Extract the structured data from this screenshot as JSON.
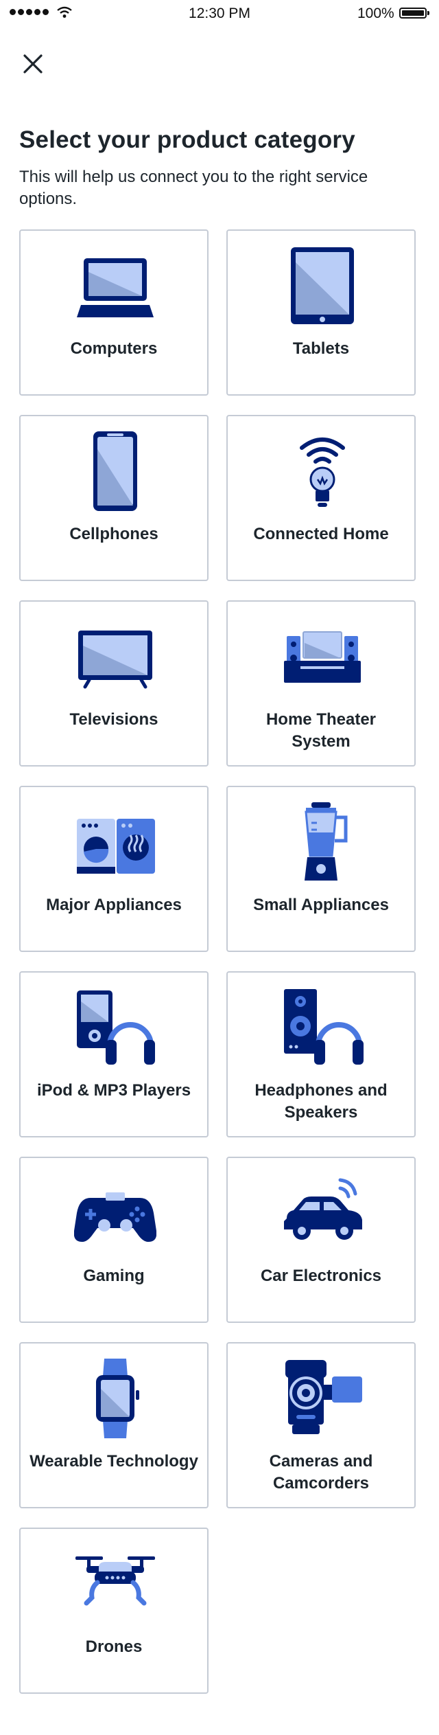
{
  "status_bar": {
    "time": "12:30 PM",
    "battery": "100%"
  },
  "header": {
    "title": "Select your product category",
    "subtitle": "This will help us connect you to the right service options."
  },
  "colors": {
    "navy": "#001e73",
    "blue": "#4a78e0",
    "light_blue": "#b9cdf7",
    "slate": "#8ea6d6",
    "border": "#c5cbd5"
  },
  "categories": [
    {
      "label": "Computers",
      "icon": "laptop-icon"
    },
    {
      "label": "Tablets",
      "icon": "tablet-icon"
    },
    {
      "label": "Cellphones",
      "icon": "cellphone-icon"
    },
    {
      "label": "Connected Home",
      "icon": "smart-bulb-icon"
    },
    {
      "label": "Televisions",
      "icon": "television-icon"
    },
    {
      "label": "Home Theater System",
      "icon": "home-theater-icon"
    },
    {
      "label": "Major Appliances",
      "icon": "washer-dryer-icon"
    },
    {
      "label": "Small Appliances",
      "icon": "blender-icon"
    },
    {
      "label": "iPod & MP3 Players",
      "icon": "mp3-player-headphones-icon"
    },
    {
      "label": "Headphones and Speakers",
      "icon": "speaker-headphones-icon"
    },
    {
      "label": "Gaming",
      "icon": "game-controller-icon"
    },
    {
      "label": "Car Electronics",
      "icon": "connected-car-icon"
    },
    {
      "label": "Wearable Technology",
      "icon": "smartwatch-icon"
    },
    {
      "label": "Cameras and Camcorders",
      "icon": "camcorder-icon"
    },
    {
      "label": "Drones",
      "icon": "drone-icon"
    }
  ]
}
